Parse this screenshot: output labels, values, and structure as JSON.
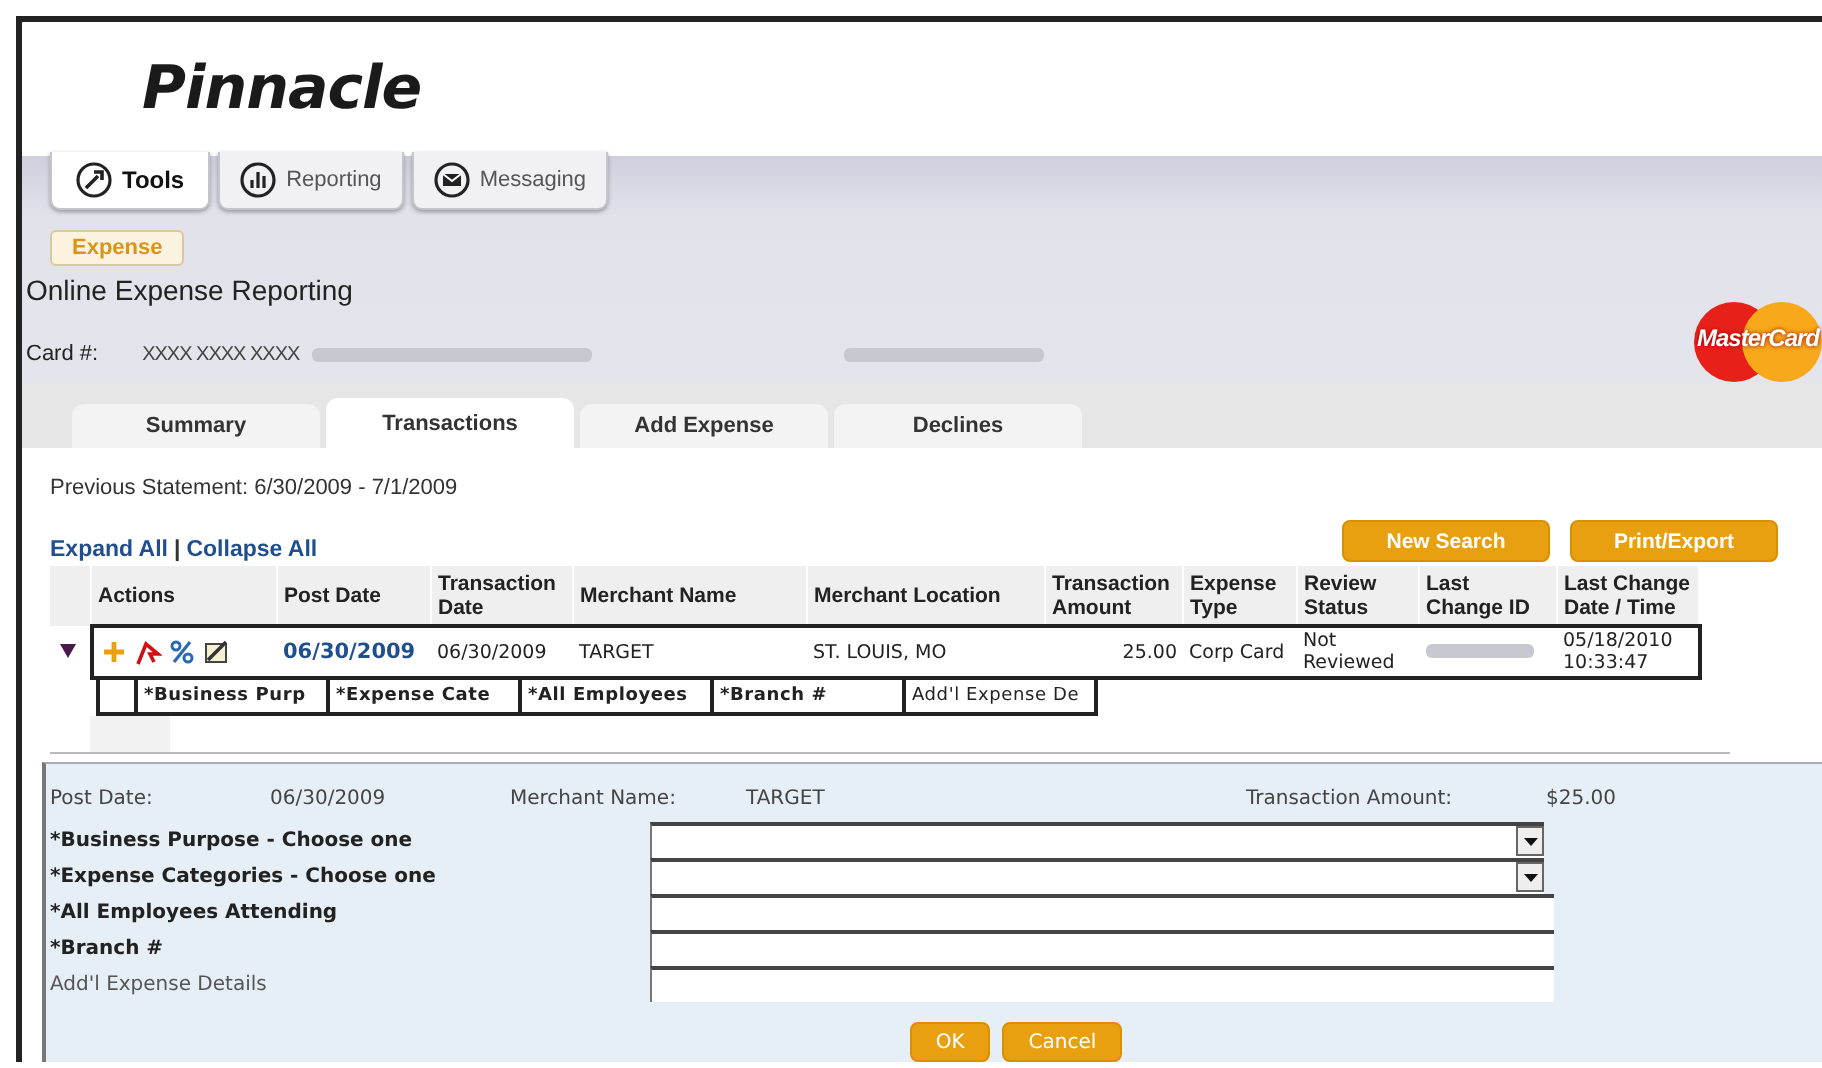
{
  "logo": {
    "text": "Pinnacle"
  },
  "nav_tabs": [
    {
      "label": "Tools",
      "selected": true
    },
    {
      "label": "Reporting",
      "selected": false
    },
    {
      "label": "Messaging",
      "selected": false
    }
  ],
  "module_tab": {
    "label": "Expense"
  },
  "page_title": "Online Expense Reporting",
  "card": {
    "label": "Card #:",
    "number": "XXXX XXXX XXXX"
  },
  "brand_logo": {
    "text": "MasterCard"
  },
  "tabs": [
    {
      "label": "Summary",
      "selected": false
    },
    {
      "label": "Transactions",
      "selected": true
    },
    {
      "label": "Add Expense",
      "selected": false
    },
    {
      "label": "Declines",
      "selected": false
    }
  ],
  "statement": "Previous Statement: 6/30/2009 - 7/1/2009",
  "links": [
    "Expand All",
    "Collapse All"
  ],
  "link_separator": "|",
  "buttons": [
    "New Search",
    "Print/Export"
  ],
  "table": {
    "columns": [
      "Actions",
      "Post Date",
      "Transaction Date",
      "Merchant Name",
      "Merchant Location",
      "Transaction Amount",
      "Expense Type",
      "Review Status",
      "Last Change ID",
      "Last Change Date / Time"
    ],
    "rows": [
      {
        "expanded": true,
        "post_date": "06/30/2009",
        "transaction_date": "06/30/2009",
        "merchant_name": "TARGET",
        "merchant_location": "ST. LOUIS, MO",
        "amount": "25.00",
        "expense_type": "Corp Card",
        "review_status": "Not Reviewed",
        "last_change": "05/18/2010 10:33:47"
      }
    ],
    "sub_columns": [
      "*Business Purp",
      "*Expense Cate",
      "*All Employees",
      "*Branch #",
      "Add'l Expense De"
    ]
  },
  "detail": {
    "summary": [
      {
        "label": "Post Date:",
        "value": "06/30/2009"
      },
      {
        "label": "Merchant Name:",
        "value": "TARGET"
      },
      {
        "label": "Transaction Amount:",
        "value": "$25.00"
      }
    ],
    "fields": [
      {
        "label": "*Business Purpose - Choose one",
        "required": true,
        "kind": "select"
      },
      {
        "label": "*Expense Categories - Choose one",
        "required": true,
        "kind": "select"
      },
      {
        "label": "*All Employees Attending",
        "required": true,
        "kind": "text"
      },
      {
        "label": "*Branch #",
        "required": true,
        "kind": "text"
      },
      {
        "label": "Add'l Expense Details",
        "required": false,
        "kind": "text"
      }
    ],
    "buttons": [
      "OK",
      "Cancel"
    ]
  }
}
